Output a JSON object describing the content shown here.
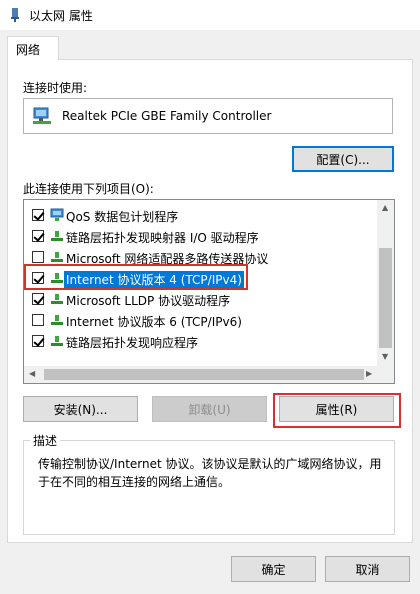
{
  "window": {
    "title": "以太网 属性"
  },
  "tabs": [
    {
      "label": "网络"
    }
  ],
  "connect_using": {
    "label": "连接时使用:",
    "adapter": "Realtek PCIe GBE Family Controller",
    "configure_button": "配置(C)..."
  },
  "items_section": {
    "label": "此连接使用下列项目(O):",
    "items": [
      {
        "text": "QoS 数据包计划程序",
        "checked": true,
        "icon": "network-service-icon"
      },
      {
        "text": "链路层拓扑发现映射器 I/O 驱动程序",
        "checked": true,
        "icon": "network-protocol-icon"
      },
      {
        "text": "Microsoft 网络适配器多路传送器协议",
        "checked": false,
        "icon": "network-protocol-icon"
      },
      {
        "text": "Internet 协议版本 4 (TCP/IPv4)",
        "checked": true,
        "icon": "network-protocol-icon",
        "selected": true
      },
      {
        "text": "Microsoft LLDP 协议驱动程序",
        "checked": true,
        "icon": "network-protocol-icon"
      },
      {
        "text": "Internet 协议版本 6 (TCP/IPv6)",
        "checked": false,
        "icon": "network-protocol-icon"
      },
      {
        "text": "链路层拓扑发现响应程序",
        "checked": true,
        "icon": "network-protocol-icon"
      }
    ]
  },
  "buttons": {
    "install": "安装(N)...",
    "uninstall": "卸载(U)",
    "properties": "属性(R)",
    "ok": "确定",
    "cancel": "取消"
  },
  "description": {
    "legend": "描述",
    "text": "传输控制协议/Internet 协议。该协议是默认的广域网络协议，用于在不同的相互连接的网络上通信。"
  },
  "colors": {
    "selection": "#0078d7",
    "highlight_annotation": "#d9302c"
  }
}
